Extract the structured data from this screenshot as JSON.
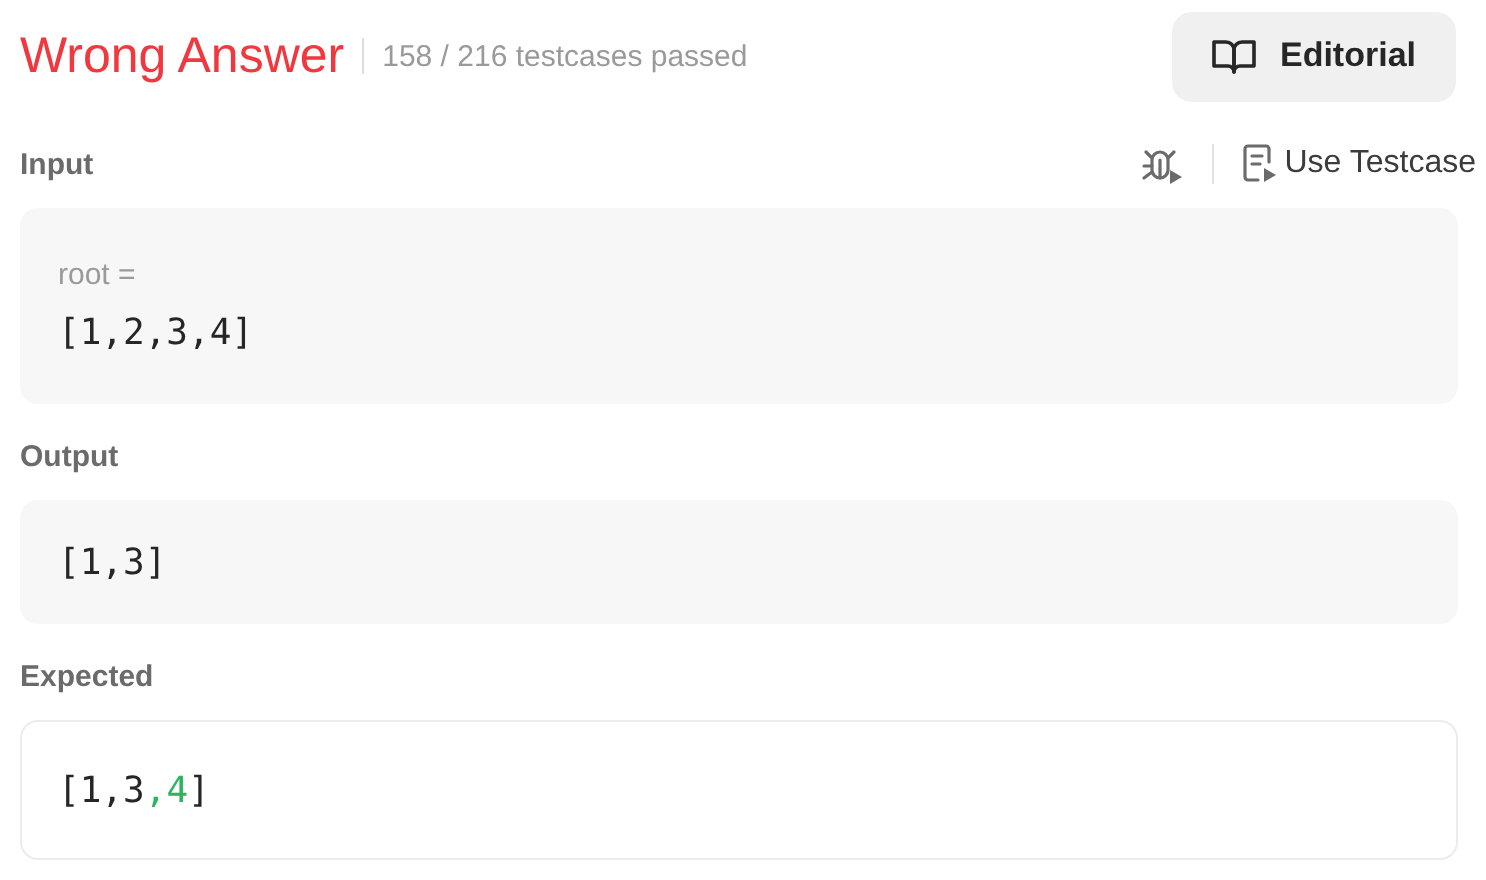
{
  "result": {
    "status": "Wrong Answer",
    "passed": "158 / 216 testcases passed"
  },
  "editorial_button": {
    "label": "Editorial"
  },
  "input": {
    "label": "Input",
    "use_testcase": "Use Testcase",
    "params": [
      {
        "name": "root =",
        "value": "[1,2,3,4]"
      }
    ]
  },
  "output": {
    "label": "Output",
    "value": "[1,3]"
  },
  "expected": {
    "label": "Expected",
    "segments": [
      {
        "text": "[1,3",
        "added": false
      },
      {
        "text": ",4",
        "added": true
      },
      {
        "text": "]",
        "added": false
      }
    ]
  }
}
